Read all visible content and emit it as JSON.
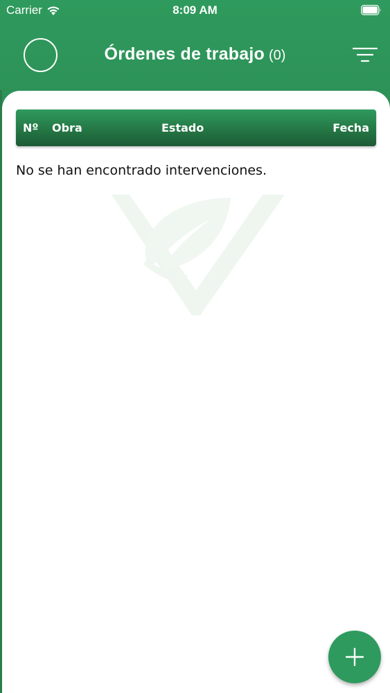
{
  "status_bar": {
    "carrier": "Carrier",
    "time": "8:09 AM"
  },
  "header": {
    "title": "Órdenes de trabajo",
    "count": "(0)",
    "avatar_icon": "user-avatar-circle",
    "filter_icon": "filter-lines-icon"
  },
  "table": {
    "columns": [
      "Nº",
      "Obra",
      "Estado",
      "Fecha"
    ]
  },
  "empty_message": "No se han encontrado intervenciones.",
  "fab": {
    "icon": "plus-icon"
  },
  "colors": {
    "primary_green": "#2e9a5e",
    "dark_green": "#1f5a37",
    "watermark": "#eef6ef"
  }
}
